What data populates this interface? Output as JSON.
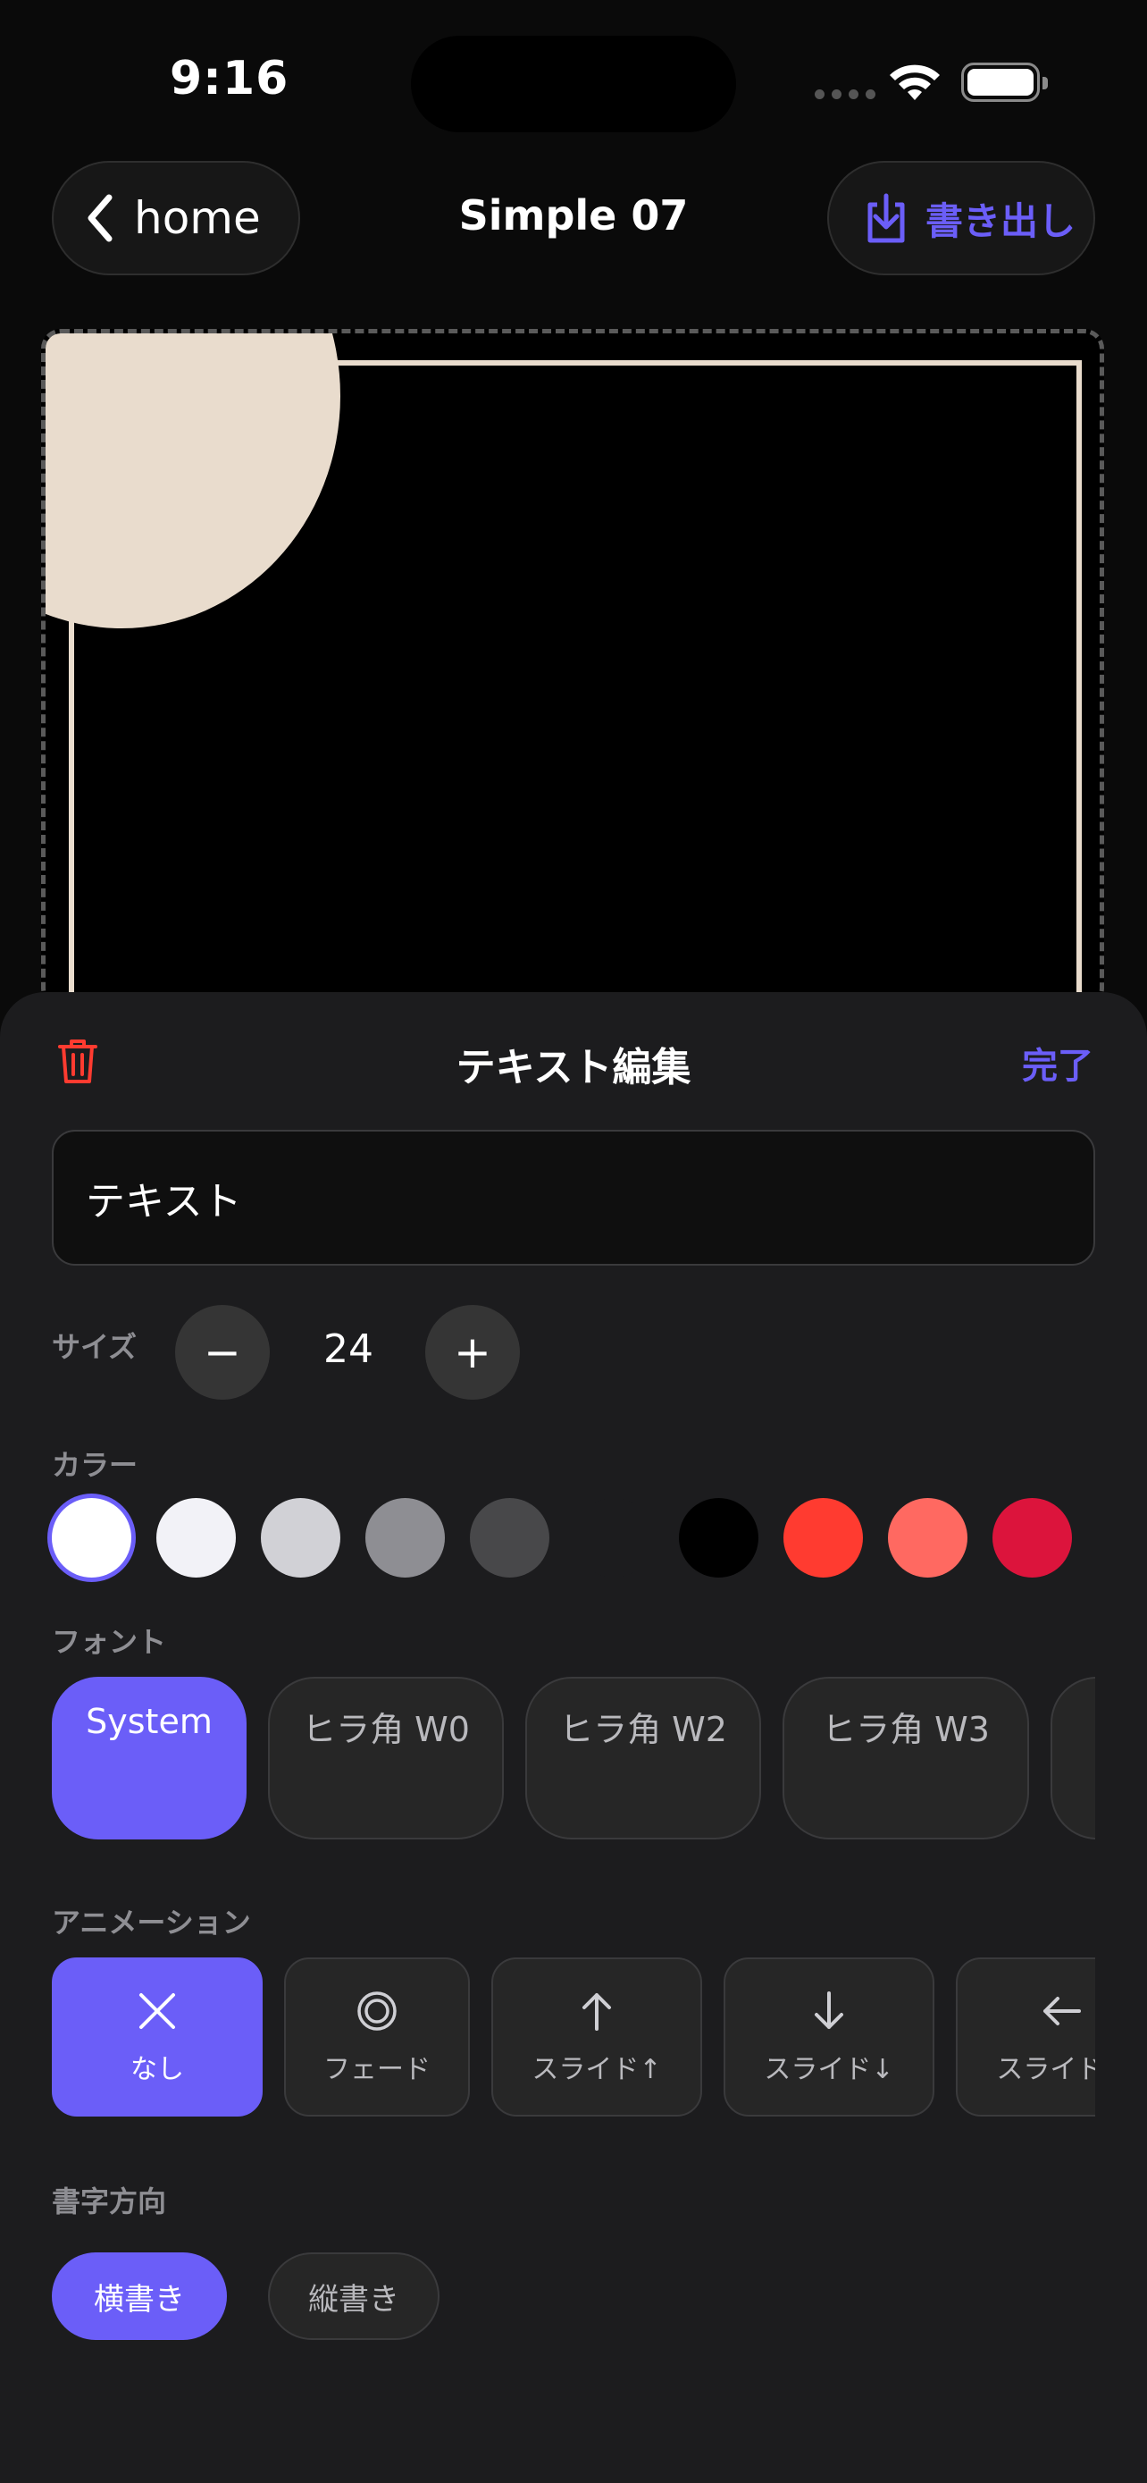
{
  "status_bar": {
    "time": "9:16"
  },
  "nav": {
    "back_label": "home",
    "title": "Simple 07",
    "export_label": "書き出し"
  },
  "sheet": {
    "title": "テキスト編集",
    "done_label": "完了",
    "text_value": "テキスト",
    "size": {
      "label": "サイズ",
      "value": "24",
      "minus": "−",
      "plus": "+"
    },
    "color": {
      "label": "カラー",
      "swatches": [
        "#ffffff",
        "#f2f2f7",
        "#d1d1d6",
        "#8e8e93",
        "#48484a",
        "#1c1c1e",
        "#000000",
        "#ff3b30",
        "#ff6961",
        "#dc143c"
      ],
      "selected_index": 0
    },
    "font": {
      "label": "フォント",
      "options": [
        "System",
        "ヒラ角 W0",
        "ヒラ角 W2",
        "ヒラ角 W3"
      ],
      "selected": "System"
    },
    "animation": {
      "label": "アニメーション",
      "options": [
        {
          "label": "なし",
          "icon": "x-icon"
        },
        {
          "label": "フェード",
          "icon": "fade-circle-icon"
        },
        {
          "label": "スライド↑",
          "icon": "arrow-up-icon"
        },
        {
          "label": "スライド↓",
          "icon": "arrow-down-icon"
        },
        {
          "label": "スライド←",
          "icon": "arrow-left-icon"
        }
      ],
      "selected": "なし"
    },
    "direction": {
      "label": "書字方向",
      "horizontal": "横書き",
      "vertical": "縦書き",
      "selected": "横書き"
    }
  },
  "colors": {
    "accent": "#6b5ef8",
    "delete": "#ff3b30",
    "sheet_bg": "#1c1c1e",
    "canvas_shape": "#e9dccd"
  }
}
